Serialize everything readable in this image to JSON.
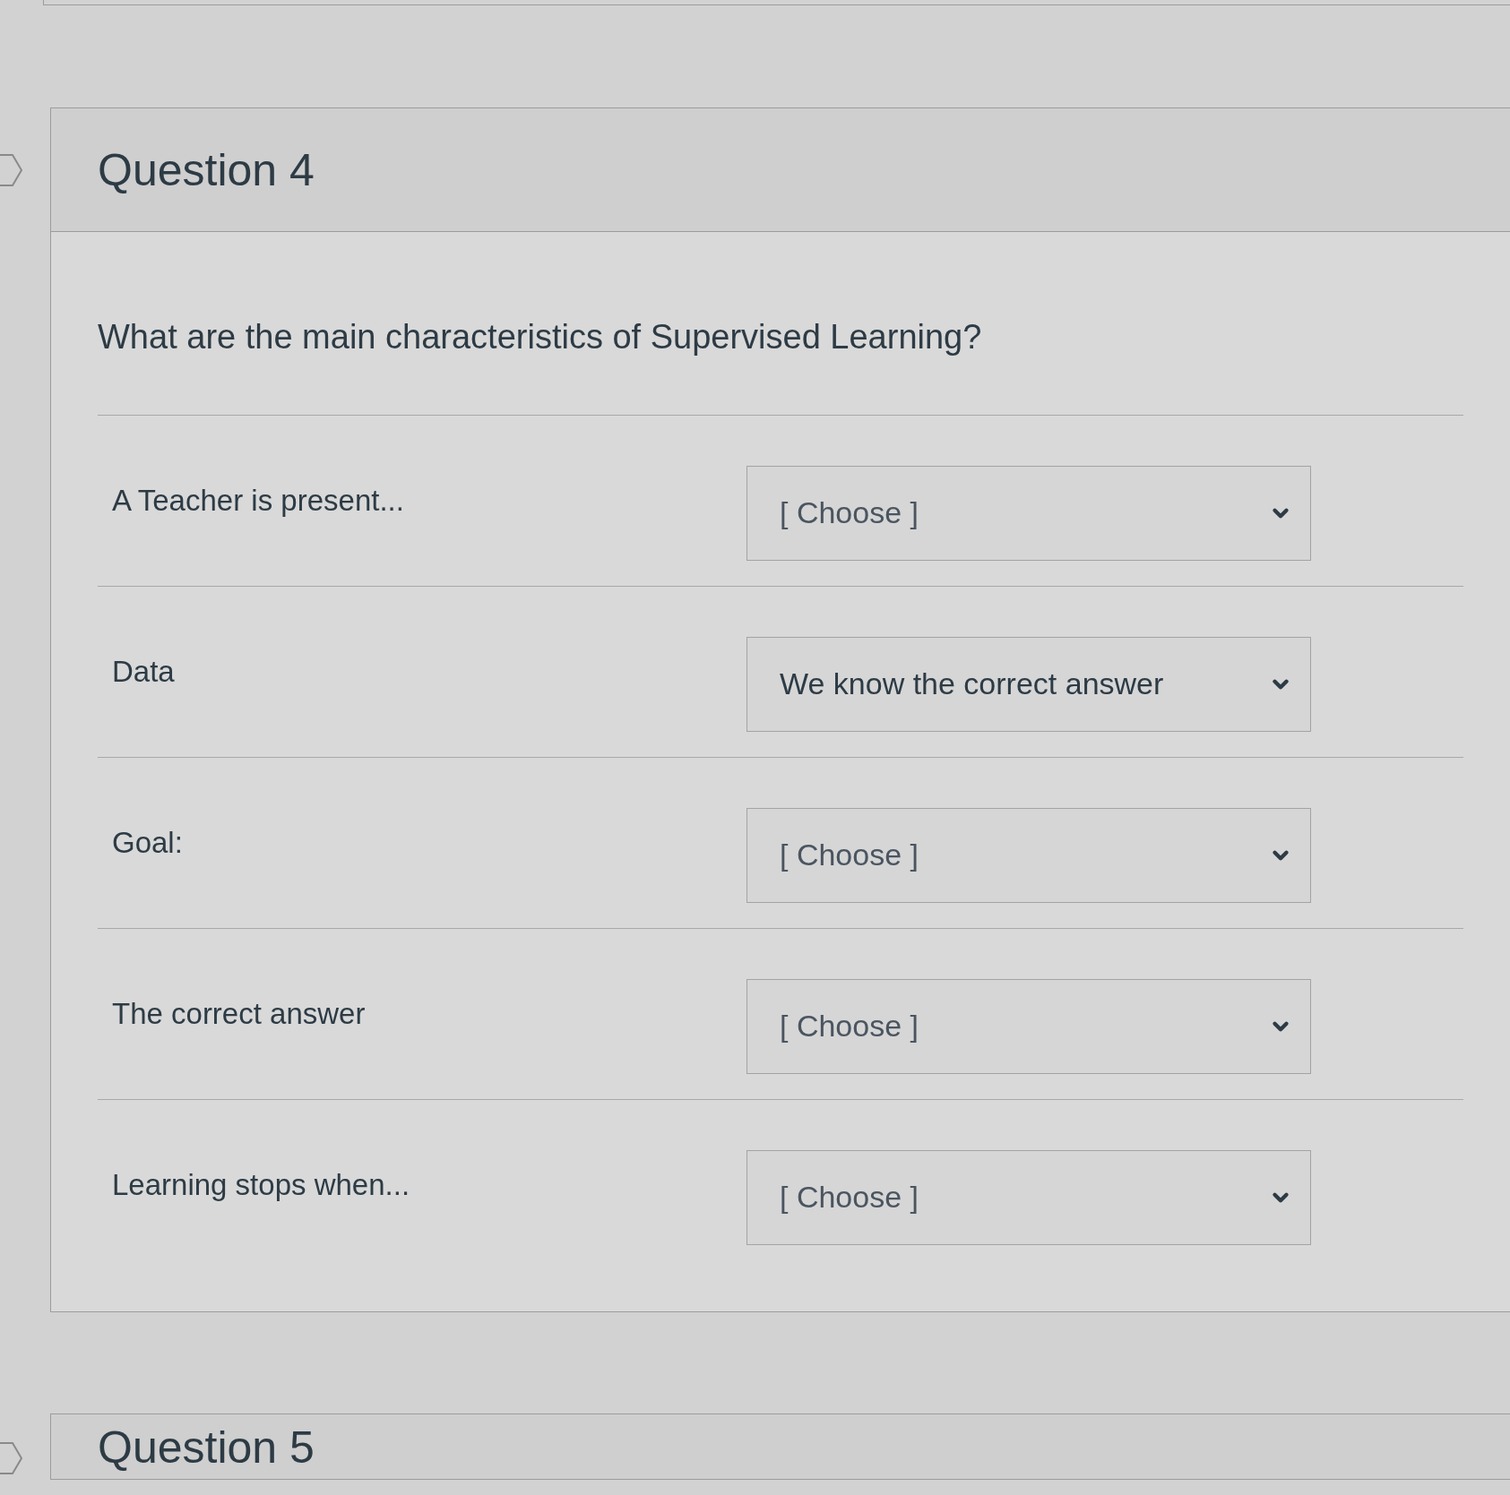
{
  "questions": [
    {
      "title": "Question 4",
      "prompt": "What are the main characteristics of Supervised Learning?",
      "matches": [
        {
          "label": "A Teacher is present...",
          "placeholder": "[ Choose ]"
        },
        {
          "label": "Data",
          "value": "We know the correct answer"
        },
        {
          "label": "Goal:",
          "placeholder": "[ Choose ]"
        },
        {
          "label": "The correct answer",
          "placeholder": "[ Choose ]"
        },
        {
          "label": "Learning stops when...",
          "placeholder": "[ Choose ]"
        }
      ]
    },
    {
      "title": "Question 5"
    }
  ]
}
